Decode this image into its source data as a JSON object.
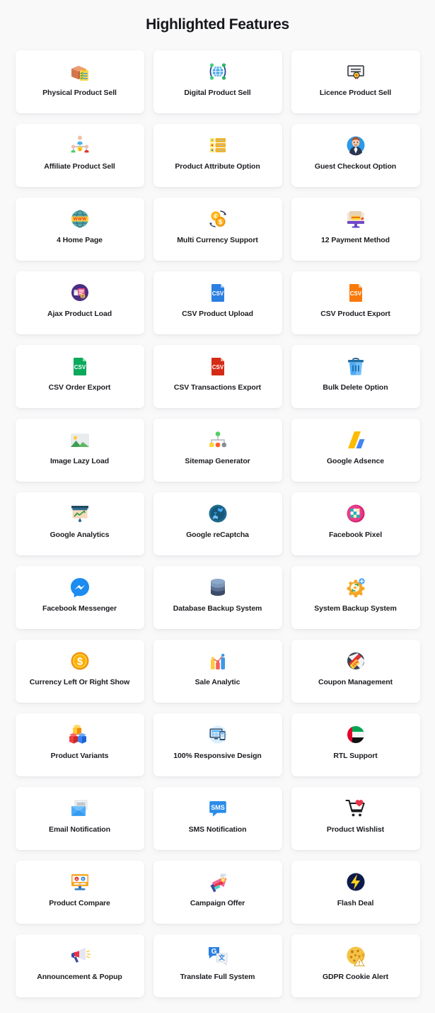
{
  "header": {
    "title": "Highlighted Features"
  },
  "theme": {
    "background": "#f9f9fa",
    "card_background": "#ffffff",
    "title_color": "#17181c",
    "label_color": "#1c1d21"
  },
  "features": [
    {
      "label": "Physical Product Sell",
      "icon": "package-box-checklist-icon"
    },
    {
      "label": "Digital Product Sell",
      "icon": "globe-network-icon"
    },
    {
      "label": "Licence Product Sell",
      "icon": "certificate-icon"
    },
    {
      "label": "Affiliate Product Sell",
      "icon": "affiliate-network-people-icon"
    },
    {
      "label": "Product Attribute Option",
      "icon": "attribute-list-icon"
    },
    {
      "label": "Guest Checkout Option",
      "icon": "guest-avatar-icon"
    },
    {
      "label": "4 Home Page",
      "icon": "www-globe-icon"
    },
    {
      "label": "Multi Currency Support",
      "icon": "currency-exchange-icon"
    },
    {
      "label": "12 Payment Method",
      "icon": "payment-monitor-card-icon"
    },
    {
      "label": "Ajax Product Load",
      "icon": "ajax-loader-icon"
    },
    {
      "label": "CSV Product Upload",
      "icon": "csv-file-blue-icon"
    },
    {
      "label": "CSV Product Export",
      "icon": "csv-file-orange-icon"
    },
    {
      "label": "CSV Order Export",
      "icon": "csv-file-green-icon"
    },
    {
      "label": "CSV Transactions Export",
      "icon": "csv-file-red-icon"
    },
    {
      "label": "Bulk Delete Option",
      "icon": "trash-bin-icon"
    },
    {
      "label": "Image Lazy Load",
      "icon": "image-photo-icon"
    },
    {
      "label": "Sitemap Generator",
      "icon": "sitemap-tree-icon"
    },
    {
      "label": "Google Adsence",
      "icon": "google-adsense-icon"
    },
    {
      "label": "Google Analytics",
      "icon": "analytics-chart-board-icon"
    },
    {
      "label": "Google reCaptcha",
      "icon": "recaptcha-icon"
    },
    {
      "label": "Facebook Pixel",
      "icon": "facebook-pixel-icon"
    },
    {
      "label": "Facebook Messenger",
      "icon": "facebook-messenger-icon"
    },
    {
      "label": "Database Backup System",
      "icon": "database-cylinder-icon"
    },
    {
      "label": "System Backup System",
      "icon": "gear-sync-icon"
    },
    {
      "label": "Currency Left Or Right Show",
      "icon": "dollar-coin-icon"
    },
    {
      "label": "Sale Analytic",
      "icon": "bar-chart-icon"
    },
    {
      "label": "Coupon Management",
      "icon": "coupon-tag-icon"
    },
    {
      "label": "Product Variants",
      "icon": "cubes-variants-icon"
    },
    {
      "label": "100% Responsive Design",
      "icon": "responsive-devices-icon"
    },
    {
      "label": "RTL Support",
      "icon": "uae-flag-circle-icon"
    },
    {
      "label": "Email Notification",
      "icon": "email-envelope-icon"
    },
    {
      "label": "SMS Notification",
      "icon": "sms-bubble-icon"
    },
    {
      "label": "Product Wishlist",
      "icon": "cart-heart-icon"
    },
    {
      "label": "Product Compare",
      "icon": "compare-ab-monitor-icon"
    },
    {
      "label": "Campaign Offer",
      "icon": "campaign-megaphone-icon"
    },
    {
      "label": "Flash Deal",
      "icon": "flash-bolt-icon"
    },
    {
      "label": "Announcement & Popup",
      "icon": "announcement-megaphone-icon"
    },
    {
      "label": "Translate Full System",
      "icon": "google-translate-icon"
    },
    {
      "label": "GDPR Cookie Alert",
      "icon": "cookie-alert-icon"
    }
  ]
}
